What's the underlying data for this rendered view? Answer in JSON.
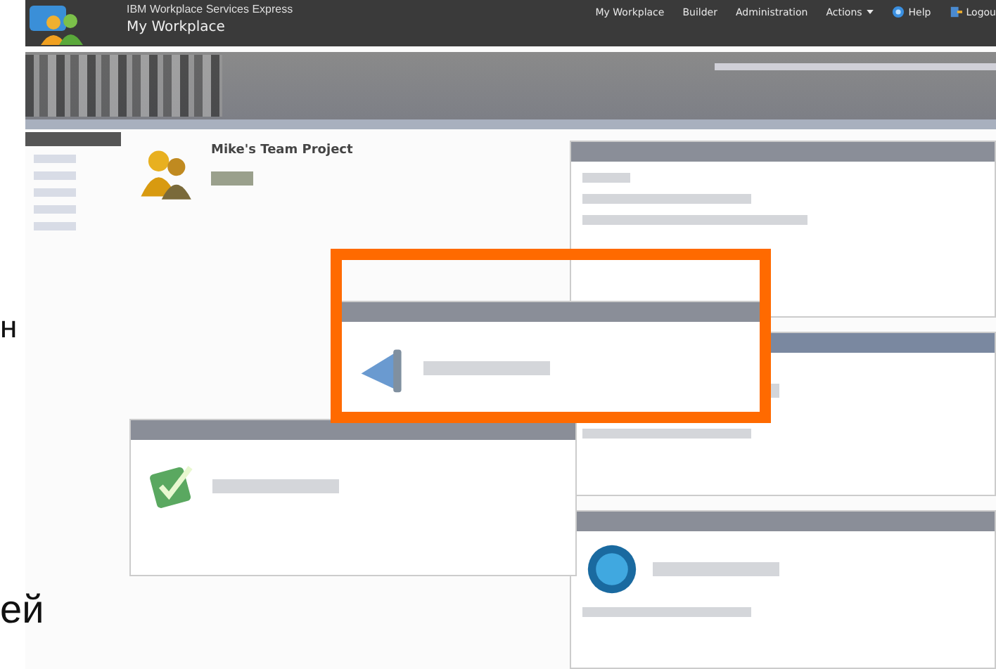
{
  "slide_text": [
    "н",
    "ей"
  ],
  "header": {
    "product": "IBM Workplace Services Express",
    "page_title": "My Workplace",
    "nav": [
      {
        "label": "My Workplace",
        "kind": "link"
      },
      {
        "label": "Builder",
        "kind": "link"
      },
      {
        "label": "Administration",
        "kind": "link"
      },
      {
        "label": "Actions",
        "kind": "menu"
      },
      {
        "label": "Help",
        "kind": "help"
      },
      {
        "label": "Logou",
        "kind": "logout"
      }
    ]
  },
  "sidebar": {
    "items": [
      {
        "selected": true
      },
      {
        "selected": false
      },
      {
        "selected": false
      },
      {
        "selected": false
      },
      {
        "selected": false
      },
      {
        "selected": false
      }
    ]
  },
  "project": {
    "title": "Mike's Team Project"
  }
}
